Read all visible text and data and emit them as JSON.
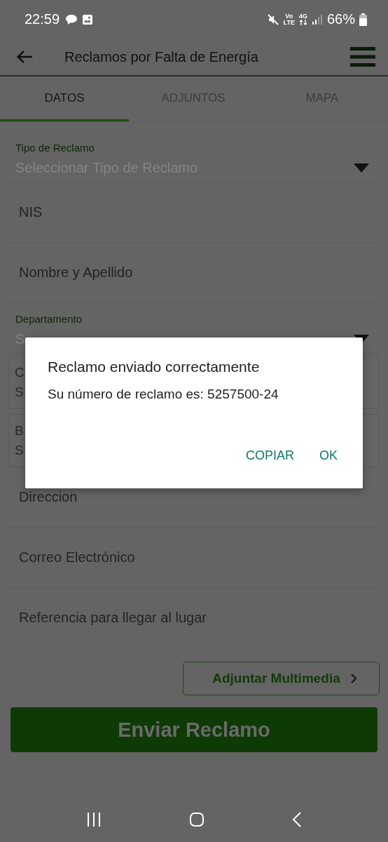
{
  "status_bar": {
    "time": "22:59",
    "volte": [
      "Vo",
      "LTE"
    ],
    "network": "4G",
    "battery": "66%"
  },
  "app_bar": {
    "title": "Reclamos por Falta de Energía"
  },
  "tabs": [
    {
      "label": "DATOS",
      "selected": true
    },
    {
      "label": "ADJUNTOS",
      "selected": false
    },
    {
      "label": "MAPA",
      "selected": false
    }
  ],
  "fields": [
    {
      "kind": "dropdown",
      "label": "Tipo de Reclamo",
      "placeholder": "Seleccionar Tipo de Reclamo"
    },
    {
      "kind": "text",
      "placeholder": "NIS"
    },
    {
      "kind": "text",
      "placeholder": "Nombre y Apellido"
    },
    {
      "kind": "dropdown",
      "label": "Departamento",
      "placeholder": "S"
    },
    {
      "kind": "card",
      "lines": [
        "C",
        "S"
      ]
    },
    {
      "kind": "card",
      "lines": [
        "B",
        "S"
      ]
    },
    {
      "kind": "text",
      "placeholder": "Direccion"
    },
    {
      "kind": "text",
      "placeholder": "Correo Electrónico"
    },
    {
      "kind": "text",
      "placeholder": "Referencia para llegar al lugar"
    }
  ],
  "attach_button": "Adjuntar Multimedia",
  "submit_button": "Enviar Reclamo",
  "dialog": {
    "title": "Reclamo enviado correctamente",
    "message": "Su número de reclamo es: 5257500-24",
    "buttons": [
      "COPIAR",
      "OK"
    ]
  }
}
